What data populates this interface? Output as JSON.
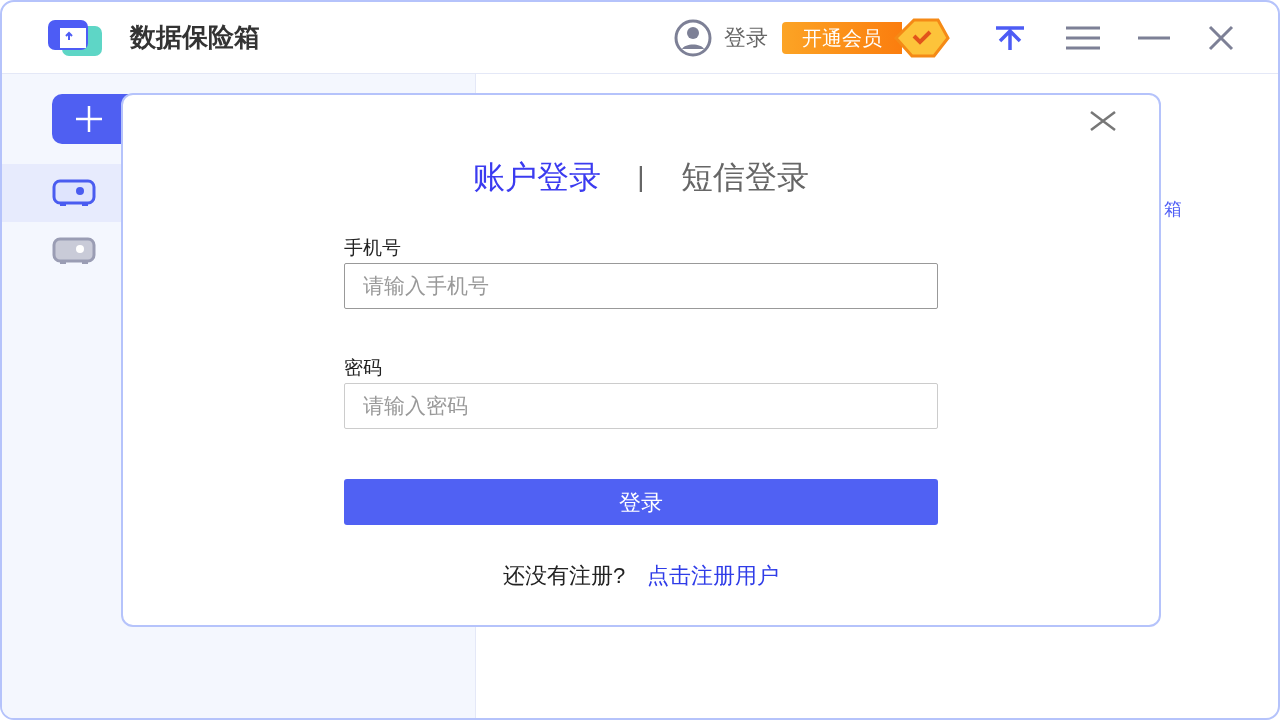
{
  "app": {
    "title": "数据保险箱"
  },
  "header": {
    "login": "登录",
    "vip": "开通会员"
  },
  "sidebar": {
    "items": [
      {
        "selected": true
      },
      {
        "selected": false
      }
    ]
  },
  "main": {
    "link_fragment": "箱"
  },
  "dialog": {
    "tabs": [
      {
        "label": "账户登录",
        "selected": true
      },
      {
        "label": "短信登录",
        "selected": false
      }
    ],
    "separator": "|",
    "fields": [
      {
        "label": "手机号",
        "placeholder": "请输入手机号"
      },
      {
        "label": "密码",
        "placeholder": "请输入密码"
      }
    ],
    "submit": "登录",
    "prompt": "还没有注册?",
    "register_link": "点击注册用户"
  }
}
